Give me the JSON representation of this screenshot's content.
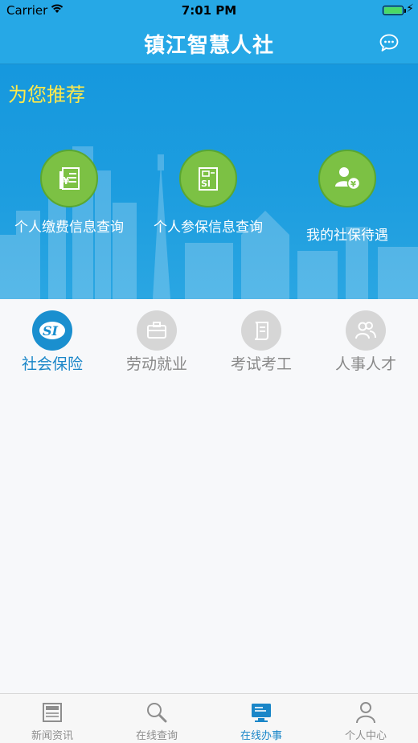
{
  "status_bar": {
    "carrier": "Carrier",
    "time": "7:01 PM"
  },
  "header": {
    "title": "镇江智慧人社",
    "chat_icon": "chat-bubble-icon"
  },
  "recommend": {
    "title": "为您推荐",
    "items": [
      {
        "label": "个人缴费信息查询",
        "icon": "payment-doc-icon"
      },
      {
        "label": "个人参保信息查询",
        "icon": "si-card-icon"
      },
      {
        "label": "我的社保待遇",
        "icon": "user-yuan-icon"
      }
    ]
  },
  "categories": [
    {
      "label": "社会保险",
      "icon": "si-logo-icon",
      "active": true
    },
    {
      "label": "劳动就业",
      "icon": "briefcase-icon",
      "active": false
    },
    {
      "label": "考试考工",
      "icon": "scroll-icon",
      "active": false
    },
    {
      "label": "人事人才",
      "icon": "people-icon",
      "active": false
    }
  ],
  "tabbar": [
    {
      "label": "新闻资讯",
      "icon": "newspaper-icon",
      "active": false
    },
    {
      "label": "在线查询",
      "icon": "search-icon",
      "active": false
    },
    {
      "label": "在线办事",
      "icon": "monitor-icon",
      "active": true
    },
    {
      "label": "个人中心",
      "icon": "person-icon",
      "active": false
    }
  ],
  "colors": {
    "primary": "#26a8e6",
    "accent_green": "#7cc144",
    "recommend_title": "#ffe94a",
    "active": "#1a86c8"
  }
}
